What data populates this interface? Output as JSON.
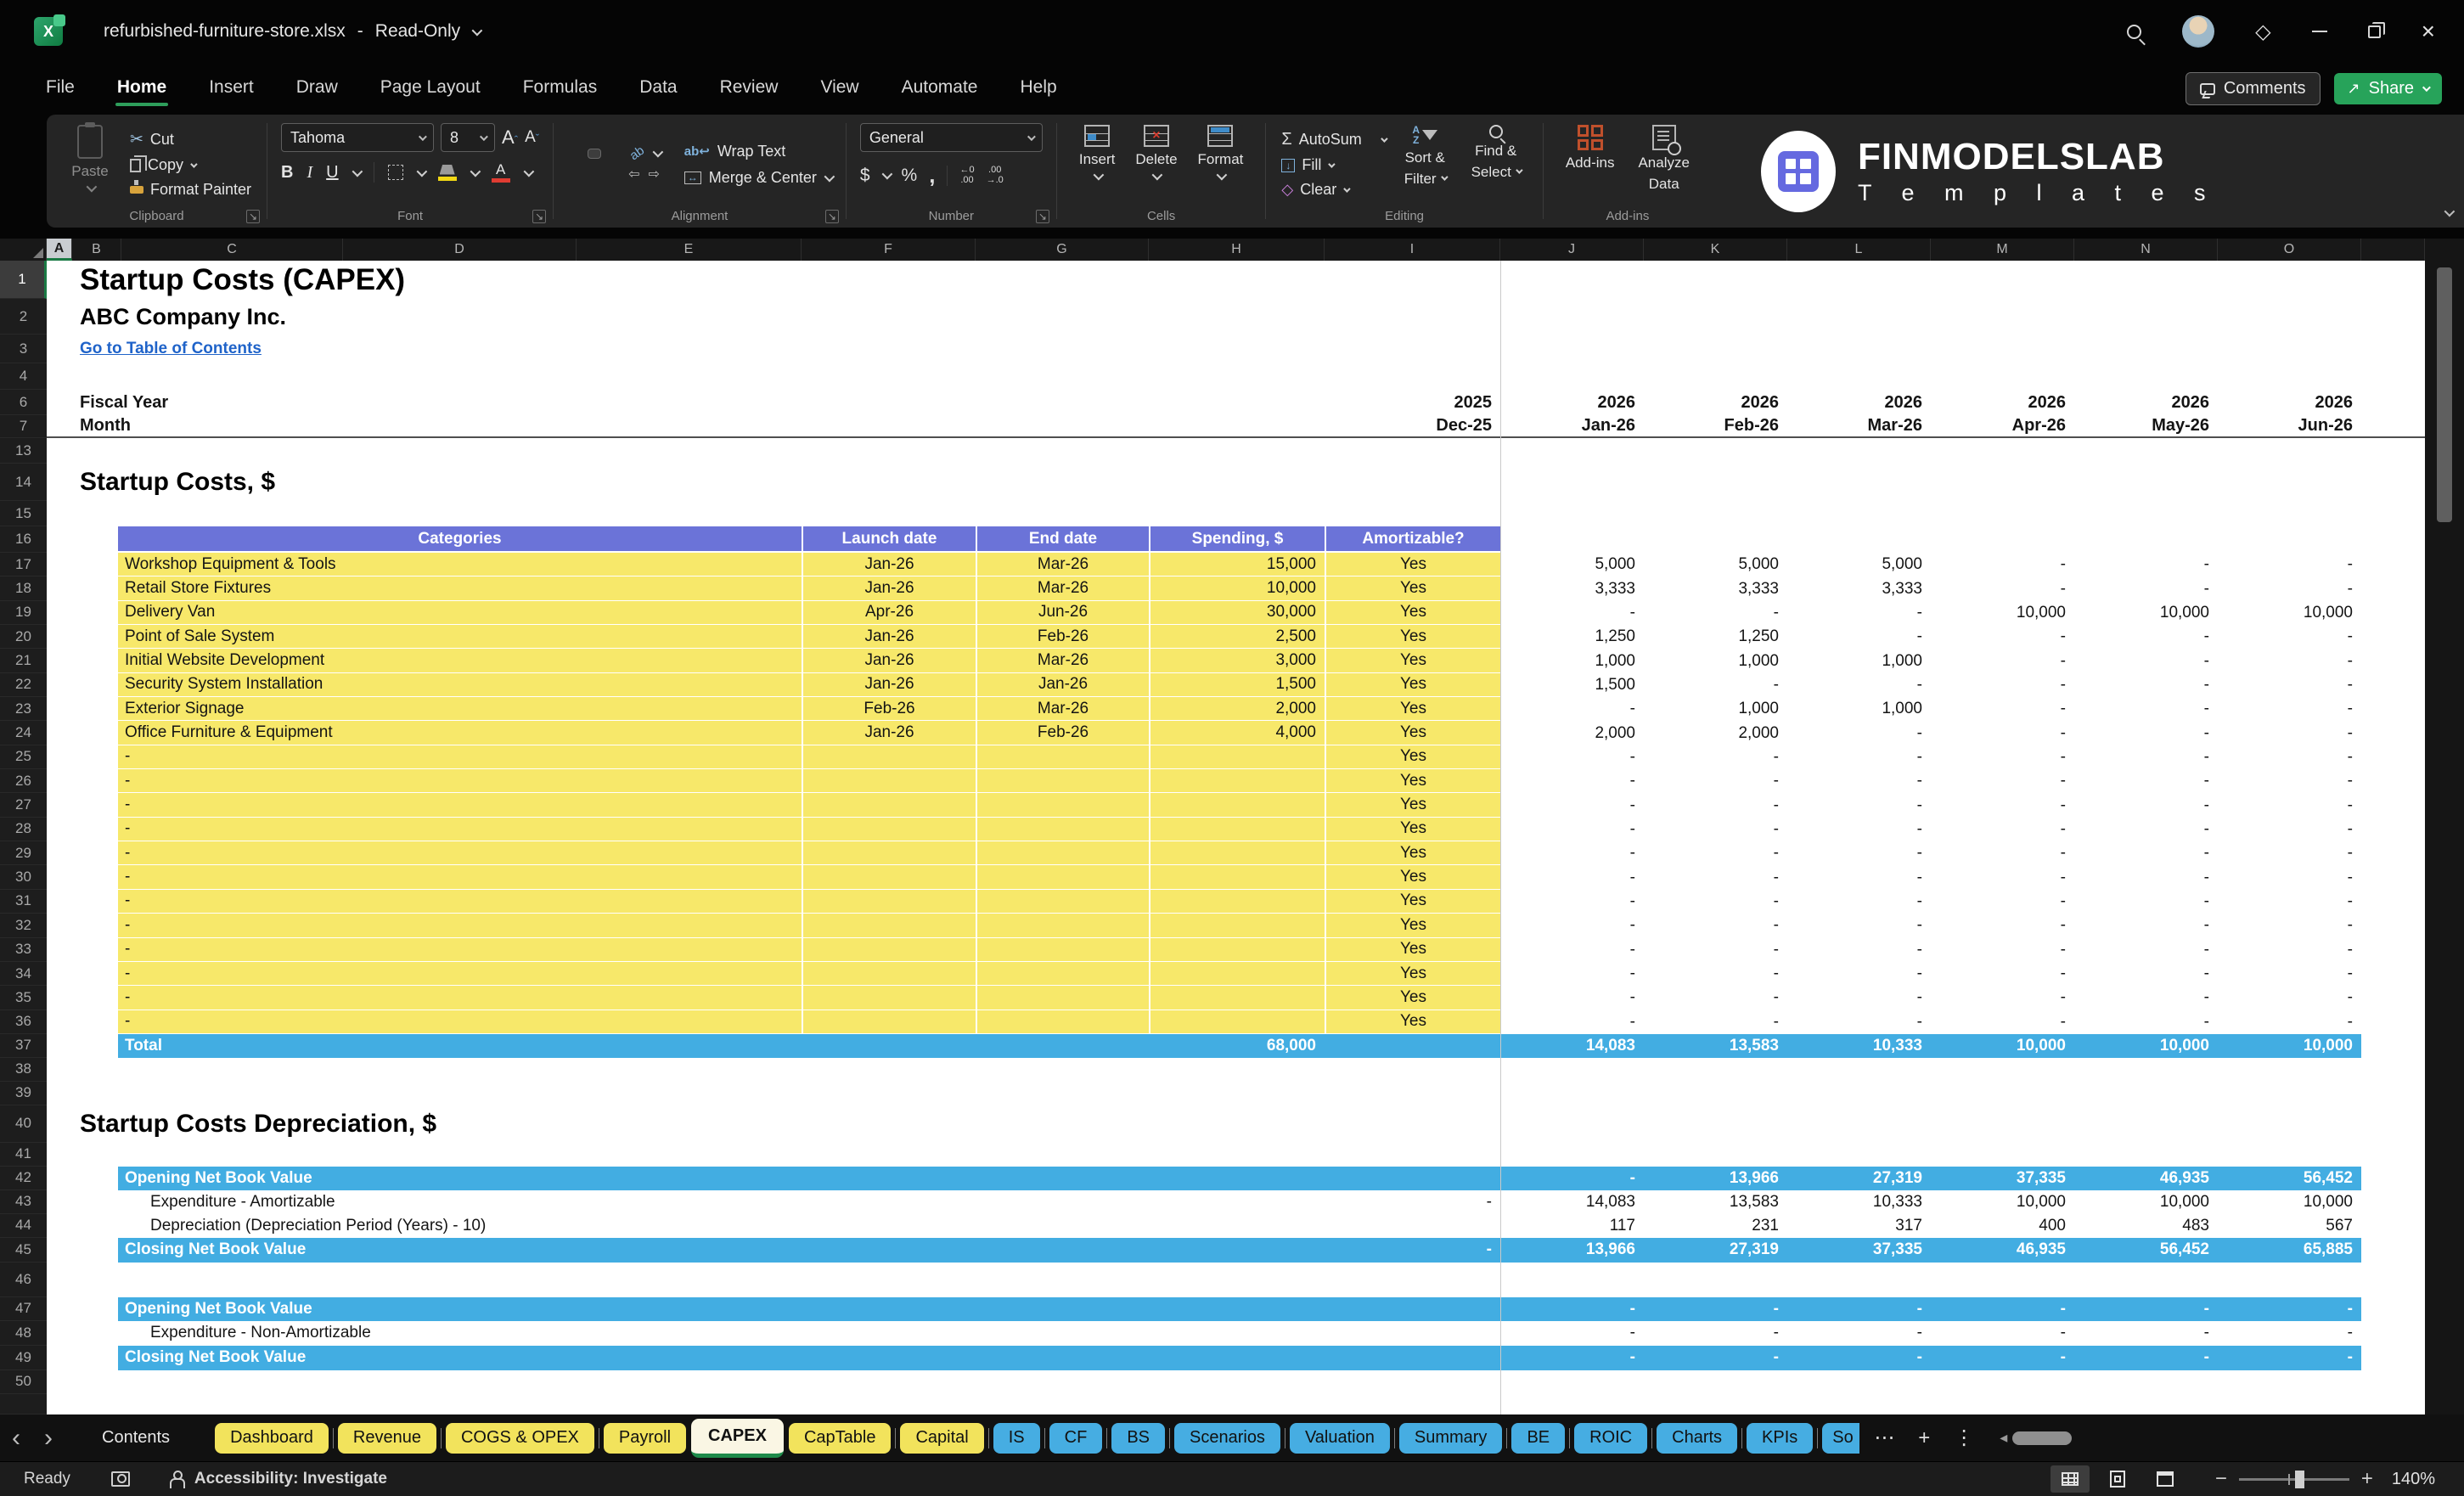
{
  "window": {
    "file": "refurbished-furniture-store.xlsx",
    "sep": "-",
    "mode": "Read-Only"
  },
  "menu": {
    "items": [
      "File",
      "Home",
      "Insert",
      "Draw",
      "Page Layout",
      "Formulas",
      "Data",
      "Review",
      "View",
      "Automate",
      "Help"
    ],
    "active_index": 1,
    "comments": "Comments",
    "share": "Share"
  },
  "ribbon": {
    "paste": "Paste",
    "cut": "Cut",
    "copy": "Copy",
    "format_painter": "Format Painter",
    "font_name": "Tahoma",
    "font_size": "8",
    "bold": "B",
    "italic": "I",
    "underline": "U",
    "wrap_text": "Wrap Text",
    "merge_center": "Merge & Center",
    "number_format": "General",
    "currency": "$",
    "percent": "%",
    "comma": ",",
    "inc_decimal_top": "←0",
    "inc_decimal_bottom": ".00",
    "dec_decimal_top": ".00",
    "dec_decimal_bottom": "→.0",
    "insert": "Insert",
    "delete": "Delete",
    "format": "Format",
    "autosum": "AutoSum",
    "fill": "Fill",
    "clear": "Clear",
    "sort1": "Sort &",
    "sort2": "Filter",
    "find1": "Find &",
    "find2": "Select",
    "addins": "Add-ins",
    "analyze1": "Analyze",
    "analyze2": "Data",
    "groups": {
      "clipboard": "Clipboard",
      "font": "Font",
      "alignment": "Alignment",
      "number": "Number",
      "cells": "Cells",
      "editing": "Editing",
      "addins": "Add-ins"
    }
  },
  "logo": {
    "title": "FINMODELSLAB",
    "subtitle": "T e m p l a t e s"
  },
  "grid": {
    "columns": [
      "A",
      "B",
      "C",
      "D",
      "E",
      "F",
      "G",
      "H",
      "I",
      "J",
      "K",
      "L",
      "M",
      "N",
      "O"
    ],
    "rows": [
      "1",
      "2",
      "3",
      "4",
      "6",
      "7",
      "13",
      "14",
      "15",
      "16",
      "17",
      "18",
      "19",
      "20",
      "21",
      "22",
      "23",
      "24",
      "25",
      "26",
      "27",
      "28",
      "29",
      "30",
      "31",
      "32",
      "33",
      "34",
      "35",
      "36",
      "37",
      "38",
      "39",
      "40",
      "41",
      "42",
      "43",
      "44",
      "45",
      "46",
      "47",
      "48",
      "49",
      "50"
    ],
    "title": "Startup Costs (CAPEX)",
    "company": "ABC Company Inc.",
    "toc_link": "Go to Table of Contents",
    "fiscal_year_label": "Fiscal Year",
    "month_label": "Month",
    "year_row": [
      "2025",
      "2026",
      "2026",
      "2026",
      "2026",
      "2026",
      "2026"
    ],
    "month_row": [
      "Dec-25",
      "Jan-26",
      "Feb-26",
      "Mar-26",
      "Apr-26",
      "May-26",
      "Jun-26"
    ],
    "section1": "Startup Costs, $",
    "section2": "Startup Costs Depreciation, $",
    "table": {
      "headers": [
        "Categories",
        "Launch date",
        "End date",
        "Spending, $",
        "Amortizable?"
      ],
      "rows": [
        {
          "cat": "Workshop Equipment & Tools",
          "launch": "Jan-26",
          "end": "Mar-26",
          "spend": "15,000",
          "amort": "Yes",
          "m": [
            "5,000",
            "5,000",
            "5,000",
            "-",
            "-",
            "-"
          ]
        },
        {
          "cat": "Retail Store Fixtures",
          "launch": "Jan-26",
          "end": "Mar-26",
          "spend": "10,000",
          "amort": "Yes",
          "m": [
            "3,333",
            "3,333",
            "3,333",
            "-",
            "-",
            "-"
          ]
        },
        {
          "cat": "Delivery Van",
          "launch": "Apr-26",
          "end": "Jun-26",
          "spend": "30,000",
          "amort": "Yes",
          "m": [
            "-",
            "-",
            "-",
            "10,000",
            "10,000",
            "10,000"
          ]
        },
        {
          "cat": "Point of Sale System",
          "launch": "Jan-26",
          "end": "Feb-26",
          "spend": "2,500",
          "amort": "Yes",
          "m": [
            "1,250",
            "1,250",
            "-",
            "-",
            "-",
            "-"
          ]
        },
        {
          "cat": "Initial Website Development",
          "launch": "Jan-26",
          "end": "Mar-26",
          "spend": "3,000",
          "amort": "Yes",
          "m": [
            "1,000",
            "1,000",
            "1,000",
            "-",
            "-",
            "-"
          ]
        },
        {
          "cat": "Security System Installation",
          "launch": "Jan-26",
          "end": "Jan-26",
          "spend": "1,500",
          "amort": "Yes",
          "m": [
            "1,500",
            "-",
            "-",
            "-",
            "-",
            "-"
          ]
        },
        {
          "cat": "Exterior Signage",
          "launch": "Feb-26",
          "end": "Mar-26",
          "spend": "2,000",
          "amort": "Yes",
          "m": [
            "-",
            "1,000",
            "1,000",
            "-",
            "-",
            "-"
          ]
        },
        {
          "cat": "Office Furniture & Equipment",
          "launch": "Jan-26",
          "end": "Feb-26",
          "spend": "4,000",
          "amort": "Yes",
          "m": [
            "2,000",
            "2,000",
            "-",
            "-",
            "-",
            "-"
          ]
        }
      ],
      "empty_row": {
        "cat": "-",
        "launch": "",
        "end": "",
        "spend": "",
        "amort": "Yes",
        "m": [
          "-",
          "-",
          "-",
          "-",
          "-",
          "-"
        ]
      },
      "empty_count": 12,
      "total_label": "Total",
      "total_spend": "68,000",
      "total_m": [
        "14,083",
        "13,583",
        "10,333",
        "10,000",
        "10,000",
        "10,000"
      ]
    },
    "dep": [
      {
        "label": "Opening Net Book Value",
        "style": "blue",
        "i": "",
        "m": [
          "-",
          "13,966",
          "27,319",
          "37,335",
          "46,935",
          "56,452"
        ]
      },
      {
        "label": "Expenditure - Amortizable",
        "style": "plain",
        "i": "-",
        "m": [
          "14,083",
          "13,583",
          "10,333",
          "10,000",
          "10,000",
          "10,000"
        ]
      },
      {
        "label": "Depreciation (Depreciation Period (Years) - 10)",
        "style": "plain",
        "i": "",
        "m": [
          "117",
          "231",
          "317",
          "400",
          "483",
          "567"
        ]
      },
      {
        "label": "Closing Net Book Value",
        "style": "blue",
        "i": "-",
        "m": [
          "13,966",
          "27,319",
          "37,335",
          "46,935",
          "56,452",
          "65,885"
        ]
      }
    ],
    "dep2": [
      {
        "label": "Opening Net Book Value",
        "style": "blue",
        "i": "",
        "m": [
          "-",
          "-",
          "-",
          "-",
          "-",
          "-"
        ]
      },
      {
        "label": "Expenditure - Non-Amortizable",
        "style": "plain",
        "i": "",
        "m": [
          "-",
          "-",
          "-",
          "-",
          "-",
          "-"
        ]
      },
      {
        "label": "Closing Net Book Value",
        "style": "blue",
        "i": "",
        "m": [
          "-",
          "-",
          "-",
          "-",
          "-",
          "-"
        ]
      }
    ]
  },
  "sheet_tabs": {
    "nav_prev": "‹",
    "nav_next": "›",
    "tabs": [
      {
        "label": "Contents",
        "style": "plain"
      },
      {
        "label": "Dashboard",
        "style": "yellow"
      },
      {
        "label": "Revenue",
        "style": "yellow"
      },
      {
        "label": "COGS & OPEX",
        "style": "yellow"
      },
      {
        "label": "Payroll",
        "style": "yellow"
      },
      {
        "label": "CAPEX",
        "style": "active"
      },
      {
        "label": "CapTable",
        "style": "yellow"
      },
      {
        "label": "Capital",
        "style": "yellow"
      },
      {
        "label": "IS",
        "style": "blue"
      },
      {
        "label": "CF",
        "style": "blue"
      },
      {
        "label": "BS",
        "style": "blue"
      },
      {
        "label": "Scenarios",
        "style": "blue"
      },
      {
        "label": "Valuation",
        "style": "blue"
      },
      {
        "label": "Summary",
        "style": "blue"
      },
      {
        "label": "BE",
        "style": "blue"
      },
      {
        "label": "ROIC",
        "style": "blue"
      },
      {
        "label": "Charts",
        "style": "blue"
      },
      {
        "label": "KPIs",
        "style": "blue"
      },
      {
        "label": "So",
        "style": "blue-partial"
      }
    ],
    "more": "⋯",
    "add": "+",
    "menu": "⋮",
    "hscroll_arrow": "◂"
  },
  "statusbar": {
    "ready": "Ready",
    "accessibility": "Accessibility: Investigate",
    "zoom": "140%"
  },
  "colors": {
    "accent_green": "#2e9e5b",
    "share_green": "#27a35a",
    "table_yellow": "#f7e86a",
    "header_purple": "#6b73d8",
    "band_blue": "#42ade2",
    "tab_yellow": "#f2e35c",
    "tab_blue": "#46ade2",
    "link_blue": "#1f63c9"
  }
}
